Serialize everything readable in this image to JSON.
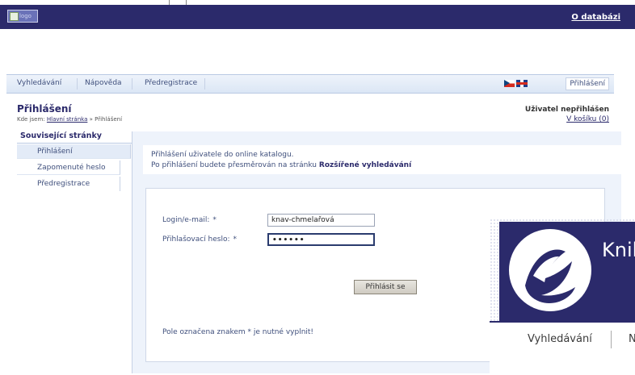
{
  "header": {
    "logo_text": "logo",
    "about_link": "O databázi"
  },
  "menu": {
    "items": [
      "Vyhledávání",
      "Nápověda",
      "Předregistrace"
    ],
    "login_tab": "Přihlášení"
  },
  "page": {
    "title": "Přihlášení",
    "breadcrumb_prefix": "Kde jsem:",
    "breadcrumb_home": "Hlavní stránka",
    "breadcrumb_sep": "»",
    "breadcrumb_current": "Přihlášení",
    "user_status": "Uživatel nepřihlášen",
    "basket": "V košíku (0)"
  },
  "related": {
    "title": "Související stránky",
    "items": [
      "Přihlášení",
      "Zapomenuté heslo",
      "Předregistrace"
    ]
  },
  "info": {
    "line1": "Přihlášení uživatele do online katalogu.",
    "line2_prefix": "Po přihlášení budete přesměrován na stránku",
    "line2_link": "Rozšířené vyhledávání"
  },
  "form": {
    "login_label": "Login/e-mail:",
    "login_value": "knav-chmelařová",
    "password_label": "Přihlašovací heslo:",
    "password_value": "••••••",
    "required_mark": "*",
    "submit_label": "Přihlásit se",
    "note": "Pole označena znakem * je nutné vyplnit!"
  },
  "overlay": {
    "logo_word": "Knil",
    "nav_items": [
      "Vyhledávání",
      "N"
    ]
  },
  "colors": {
    "brand": "#2b2a6b",
    "menu_bg": "#dbe6f5",
    "content_bg": "#eef3fb"
  }
}
